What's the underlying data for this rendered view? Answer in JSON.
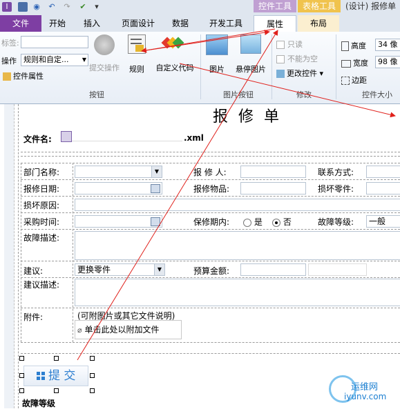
{
  "window": {
    "context_header_1": "控件工具",
    "context_header_2": "表格工具",
    "title": "(设计) 报修单"
  },
  "ribbon_tabs": [
    "文件",
    "开始",
    "插入",
    "页面设计",
    "数据",
    "开发工具",
    "属性",
    "布局"
  ],
  "ribbon": {
    "label_field": "标签:",
    "action_label": "操作",
    "action_value": "规则和自定...",
    "control_props": "控件属性",
    "submit_action": "提交操作",
    "rules": "规则",
    "custom_code": "自定义代码",
    "group_buttons": "按钮",
    "picture": "图片",
    "hover_picture": "悬停图片",
    "group_picture_buttons": "图片按钮",
    "readonly": "只读",
    "cannot_be_blank": "不能为空",
    "change_control": "更改控件",
    "group_modify": "修改",
    "height_label": "高度",
    "height_value": "34 像",
    "width_label": "宽度",
    "width_value": "98 像",
    "margin_label": "边距",
    "group_control_size": "控件大小"
  },
  "form": {
    "title": "报 修 单",
    "file_name_label": "文件名:",
    "file_ext": ".xml",
    "department_label": "部门名称:",
    "reporter_label": "报 修 人:",
    "contact_label": "联系方式:",
    "report_date_label": "报修日期:",
    "repair_item_label": "报修物品:",
    "damaged_parts_label": "损坏零件:",
    "damage_reason_label": "损坏原因:",
    "purchase_time_label": "采购时间:",
    "warranty_label": "保修期内:",
    "yes": "是",
    "no": "否",
    "fault_level_label": "故障等级:",
    "fault_level_value": "一般",
    "fault_desc_label": "故障描述:",
    "suggestion_label": "建议:",
    "suggestion_value": "更换零件",
    "budget_label": "预算金额:",
    "suggestion_desc_label": "建议描述:",
    "attachment_label": "附件:",
    "attachment_note": "(可附图片或其它文件说明)",
    "attach_action": "单击此处以附加文件",
    "submit": "提 交",
    "fault_level_heading": "故障等级"
  },
  "watermark": {
    "text1": "运维网",
    "text2": "iyunv.com"
  },
  "colors": {
    "file_tab": "#7e3ea3",
    "annotation_arrow": "#e0201b",
    "submit_text": "#2d7fd0"
  }
}
